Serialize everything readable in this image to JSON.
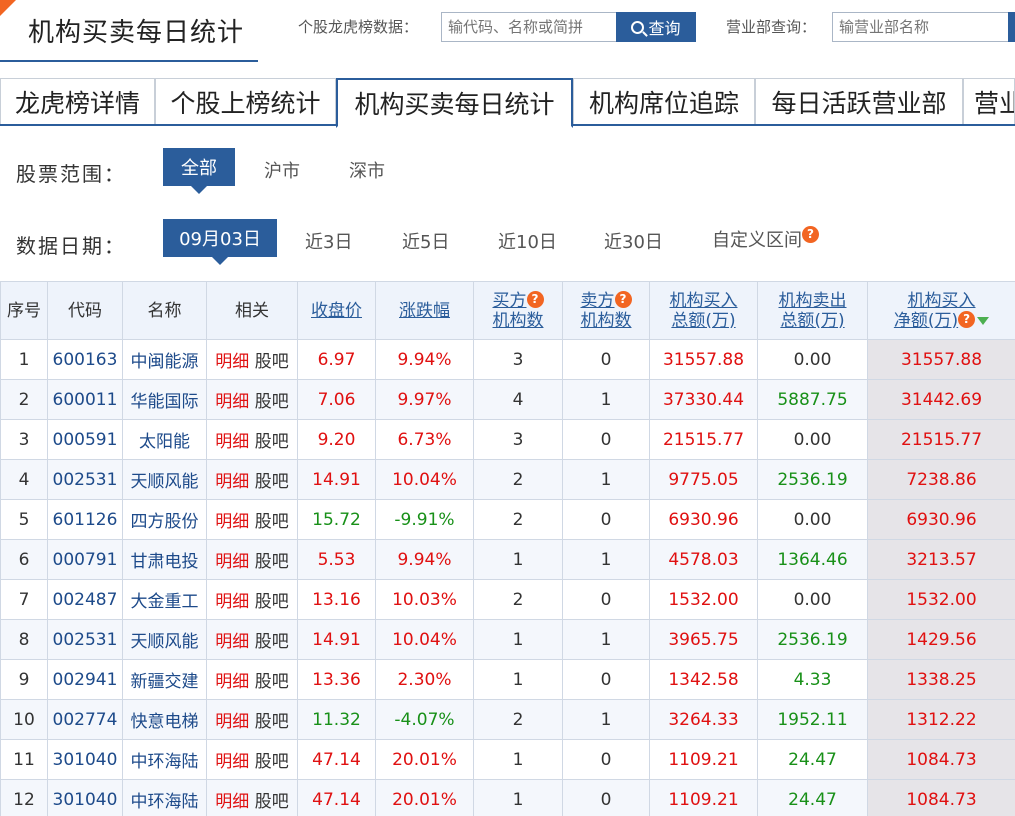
{
  "header": {
    "title": "机构买卖每日统计",
    "stock_label": "个股龙虎榜数据：",
    "stock_placeholder": "输代码、名称或简拼",
    "query_button": "查询",
    "dept_label": "营业部查询：",
    "dept_placeholder": "输营业部名称"
  },
  "tabs": [
    {
      "label": "龙虎榜详情"
    },
    {
      "label": "个股上榜统计"
    },
    {
      "label": "机构买卖每日统计",
      "active": true
    },
    {
      "label": "机构席位追踪"
    },
    {
      "label": "每日活跃营业部"
    },
    {
      "label": "营业"
    }
  ],
  "filters": {
    "scope_label": "股票范围：",
    "scope_options": [
      "全部",
      "沪市",
      "深市"
    ],
    "scope_selected": "全部",
    "date_label": "数据日期：",
    "date_options": [
      "09月03日",
      "近3日",
      "近5日",
      "近10日",
      "近30日",
      "自定义区间"
    ],
    "date_selected": "09月03日"
  },
  "table": {
    "headers": {
      "seq": "序号",
      "code": "代码",
      "name": "名称",
      "related": "相关",
      "close": "收盘价",
      "change": "涨跌幅",
      "buy_inst_1": "买方",
      "buy_inst_2": "机构数",
      "sell_inst_1": "卖方",
      "sell_inst_2": "机构数",
      "buy_total_1": "机构买入",
      "buy_total_2": "总额(万)",
      "sell_total_1": "机构卖出",
      "sell_total_2": "总额(万)",
      "net_1": "机构买入",
      "net_2": "净额(万)"
    },
    "related_links": {
      "detail": "明细",
      "bar": "股吧"
    },
    "help_glyph": "?",
    "rows": [
      {
        "seq": "1",
        "code": "600163",
        "name": "中闽能源",
        "close": "6.97",
        "change": "9.94%",
        "buy": "3",
        "sell": "0",
        "buy_total": "31557.88",
        "sell_total": "0.00",
        "net": "31557.88"
      },
      {
        "seq": "2",
        "code": "600011",
        "name": "华能国际",
        "close": "7.06",
        "change": "9.97%",
        "buy": "4",
        "sell": "1",
        "buy_total": "37330.44",
        "sell_total": "5887.75",
        "net": "31442.69"
      },
      {
        "seq": "3",
        "code": "000591",
        "name": "太阳能",
        "close": "9.20",
        "change": "6.73%",
        "buy": "3",
        "sell": "0",
        "buy_total": "21515.77",
        "sell_total": "0.00",
        "net": "21515.77"
      },
      {
        "seq": "4",
        "code": "002531",
        "name": "天顺风能",
        "close": "14.91",
        "change": "10.04%",
        "buy": "2",
        "sell": "1",
        "buy_total": "9775.05",
        "sell_total": "2536.19",
        "net": "7238.86"
      },
      {
        "seq": "5",
        "code": "601126",
        "name": "四方股份",
        "close": "15.72",
        "change": "-9.91%",
        "buy": "2",
        "sell": "0",
        "buy_total": "6930.96",
        "sell_total": "0.00",
        "net": "6930.96"
      },
      {
        "seq": "6",
        "code": "000791",
        "name": "甘肃电投",
        "close": "5.53",
        "change": "9.94%",
        "buy": "1",
        "sell": "1",
        "buy_total": "4578.03",
        "sell_total": "1364.46",
        "net": "3213.57"
      },
      {
        "seq": "7",
        "code": "002487",
        "name": "大金重工",
        "close": "13.16",
        "change": "10.03%",
        "buy": "2",
        "sell": "0",
        "buy_total": "1532.00",
        "sell_total": "0.00",
        "net": "1532.00"
      },
      {
        "seq": "8",
        "code": "002531",
        "name": "天顺风能",
        "close": "14.91",
        "change": "10.04%",
        "buy": "1",
        "sell": "1",
        "buy_total": "3965.75",
        "sell_total": "2536.19",
        "net": "1429.56"
      },
      {
        "seq": "9",
        "code": "002941",
        "name": "新疆交建",
        "close": "13.36",
        "change": "2.30%",
        "buy": "1",
        "sell": "0",
        "buy_total": "1342.58",
        "sell_total": "4.33",
        "net": "1338.25"
      },
      {
        "seq": "10",
        "code": "002774",
        "name": "快意电梯",
        "close": "11.32",
        "change": "-4.07%",
        "buy": "2",
        "sell": "1",
        "buy_total": "3264.33",
        "sell_total": "1952.11",
        "net": "1312.22"
      },
      {
        "seq": "11",
        "code": "301040",
        "name": "中环海陆",
        "close": "47.14",
        "change": "20.01%",
        "buy": "1",
        "sell": "0",
        "buy_total": "1109.21",
        "sell_total": "24.47",
        "net": "1084.73"
      },
      {
        "seq": "12",
        "code": "301040",
        "name": "中环海陆",
        "close": "47.14",
        "change": "20.01%",
        "buy": "1",
        "sell": "0",
        "buy_total": "1109.21",
        "sell_total": "24.47",
        "net": "1084.73"
      }
    ]
  },
  "colors": {
    "accent": "#2b5d9b",
    "brand": "#f26522",
    "up": "#e01010",
    "down": "#189018"
  }
}
